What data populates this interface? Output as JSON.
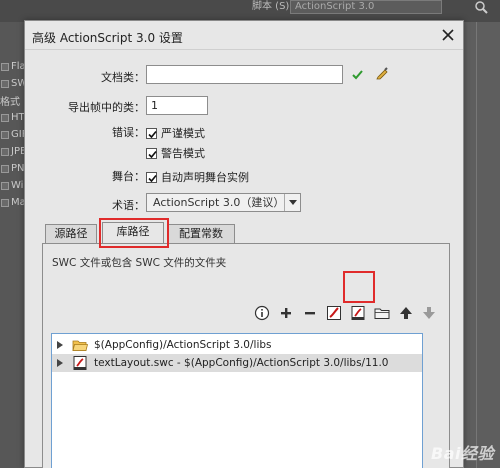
{
  "background": {
    "script_label": "脚本 (S):",
    "script_value": "ActionScript 3.0",
    "left_items": [
      "Flas",
      "SW",
      "格式",
      "HTI",
      "GIF",
      "JPE",
      "PNG",
      "Win",
      "Mac"
    ]
  },
  "dialog": {
    "title": "高级 ActionScript 3.0 设置",
    "document_class_label": "文档类：",
    "document_class_value": "",
    "export_frame_label": "导出帧中的类：",
    "export_frame_value": "1",
    "errors_label": "错误：",
    "strict_mode": {
      "label": "严谨模式",
      "checked": true
    },
    "warnings_mode": {
      "label": "警告模式",
      "checked": true
    },
    "stage_label": "舞台：",
    "auto_declare": {
      "label": "自动声明舞台实例",
      "checked": true
    },
    "dialect_label": "术语：",
    "dialect_value": "ActionScript 3.0（建议）"
  },
  "tabs": [
    {
      "label": "源路径",
      "active": false
    },
    {
      "label": "库路径",
      "active": true
    },
    {
      "label": "配置常数",
      "active": false
    }
  ],
  "library_panel": {
    "description": "SWC 文件或包含 SWC 文件的文件夹",
    "toolbar_icons": [
      "info-icon",
      "plus-icon",
      "minus-icon",
      "flex-sdk-icon",
      "swc-file-icon",
      "browse-folder-icon",
      "move-up-icon",
      "move-down-icon"
    ],
    "rows": [
      {
        "text": "$(AppConfig)/ActionScript 3.0/libs",
        "icon": "folder-icon",
        "selected": false
      },
      {
        "text": "textLayout.swc - $(AppConfig)/ActionScript 3.0/libs/11.0",
        "icon": "swc-file-icon",
        "selected": true
      }
    ]
  },
  "watermark": "Bai经验",
  "colors": {
    "highlight": "#e02b2b",
    "check": "#2f9a2f",
    "tree_border": "#6fa0d2",
    "selected_row": "#dcdcdc"
  }
}
